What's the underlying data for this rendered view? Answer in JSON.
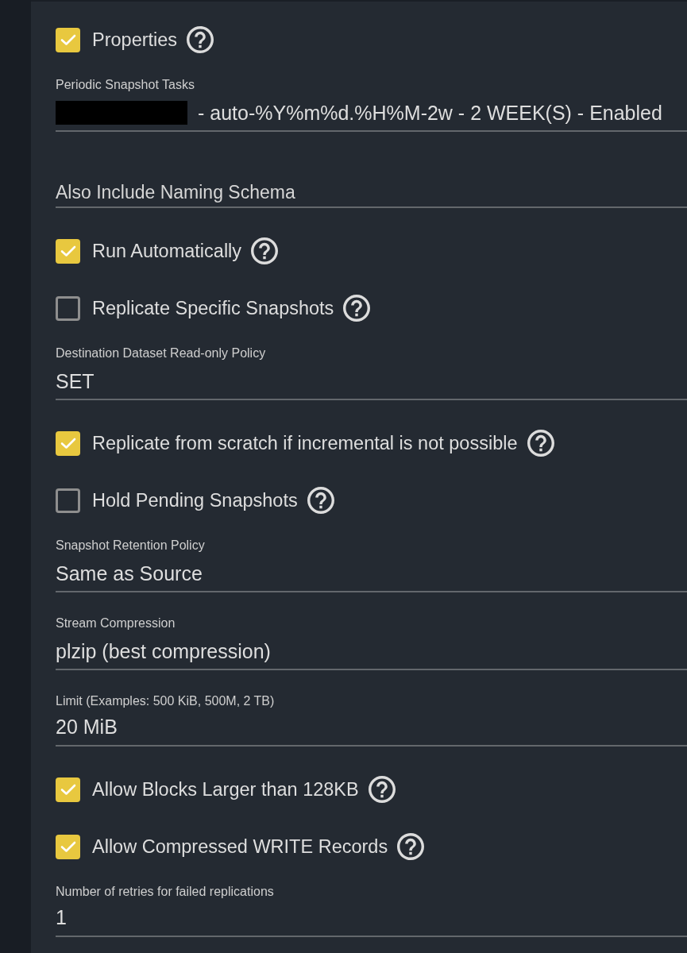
{
  "fields": [
    {
      "kind": "checkbox",
      "label": "Properties",
      "checked": true,
      "help": true
    },
    {
      "kind": "select",
      "label": "Periodic Snapshot Tasks",
      "value": "- auto-%Y%m%d.%H%M-2w - 2 WEEK(S) - Enabled",
      "redacted": true
    },
    {
      "kind": "input",
      "placeholder": "Also Include Naming Schema"
    },
    {
      "kind": "checkbox",
      "label": "Run Automatically",
      "checked": true,
      "help": true
    },
    {
      "kind": "checkbox",
      "label": "Replicate Specific Snapshots",
      "checked": false,
      "help": true
    },
    {
      "kind": "select",
      "label": "Destination Dataset Read-only Policy",
      "value": "SET"
    },
    {
      "kind": "checkbox",
      "label": "Replicate from scratch if incremental is not possible",
      "checked": true,
      "help": true
    },
    {
      "kind": "checkbox",
      "label": "Hold Pending Snapshots",
      "checked": false,
      "help": true
    },
    {
      "kind": "select",
      "label": "Snapshot Retention Policy",
      "value": "Same as Source"
    },
    {
      "kind": "select",
      "label": "Stream Compression",
      "value": "plzip (best compression)"
    },
    {
      "kind": "input",
      "label": "Limit (Examples: 500 KiB, 500M, 2 TB)",
      "value": "20 MiB"
    },
    {
      "kind": "checkbox",
      "label": "Allow Blocks Larger than 128KB",
      "checked": true,
      "help": true
    },
    {
      "kind": "checkbox",
      "label": "Allow Compressed WRITE Records",
      "checked": true,
      "help": true
    },
    {
      "kind": "input",
      "label": "Number of retries for failed replications",
      "value": "1"
    }
  ]
}
